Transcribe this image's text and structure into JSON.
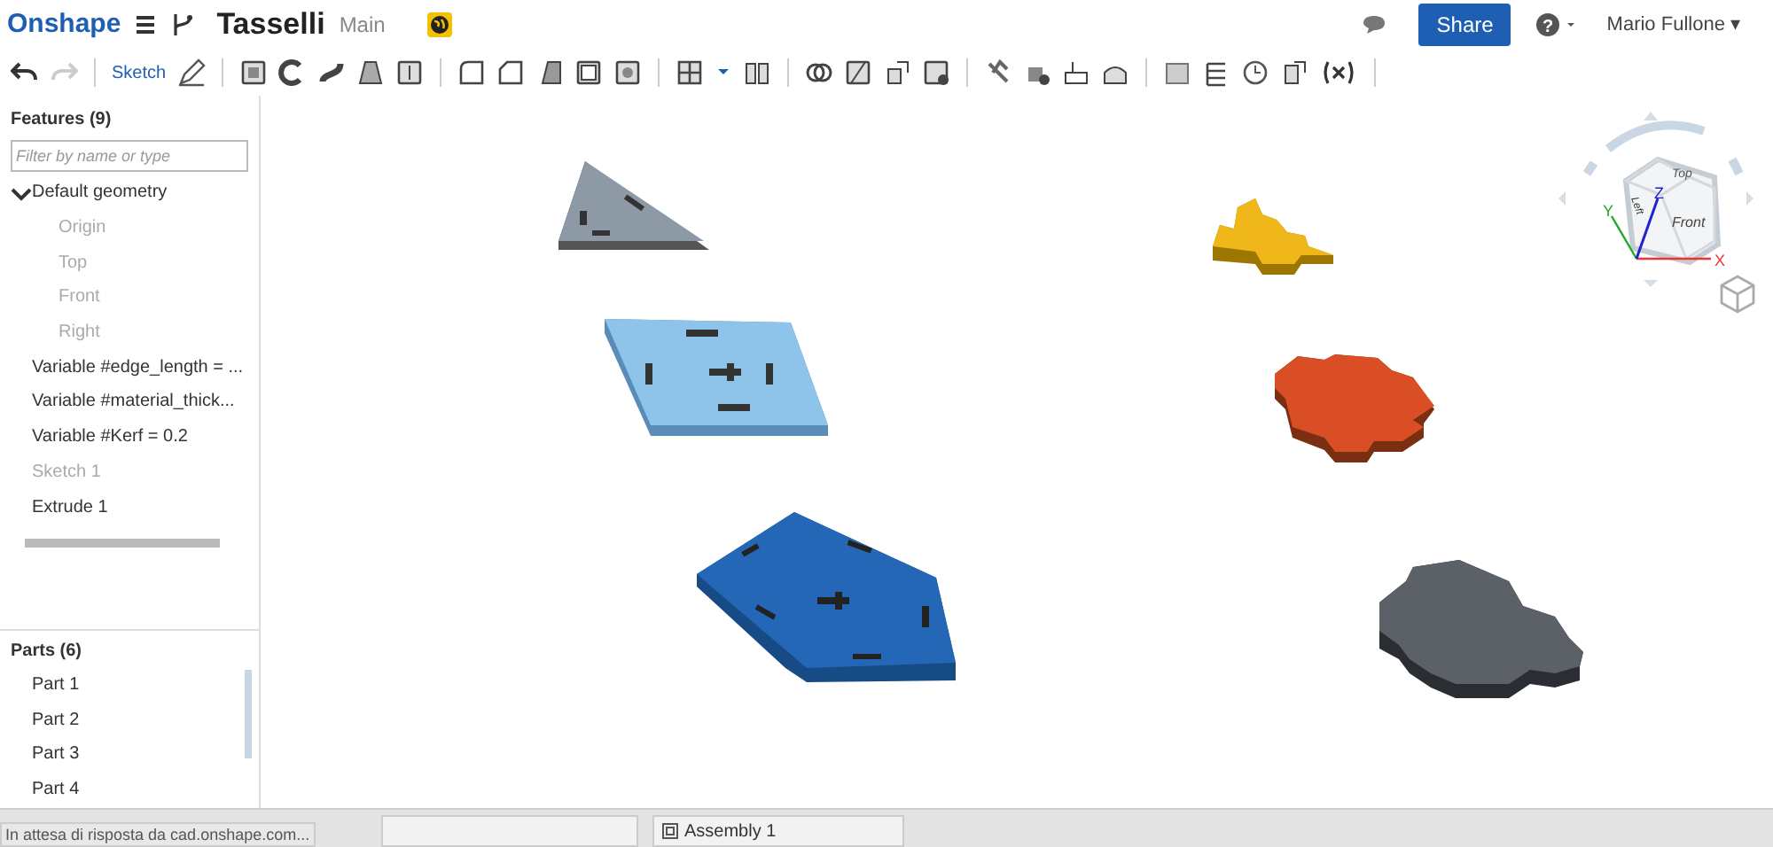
{
  "header": {
    "logo": "Onshape",
    "document_title": "Tasselli",
    "branch": "Main",
    "share": "Share",
    "help": "?",
    "user": "Mario Fullone",
    "user_caret": "▾"
  },
  "toolbar": {
    "sketch": "Sketch"
  },
  "features": {
    "title": "Features (9)",
    "filter": {
      "placeholder": "Filter by name or type"
    },
    "items": [
      {
        "label": "Default geometry",
        "expanded": true,
        "disabled": false,
        "children": [
          {
            "label": "Origin",
            "disabled": true
          },
          {
            "label": "Top",
            "disabled": true
          },
          {
            "label": "Front",
            "disabled": true
          },
          {
            "label": "Right",
            "disabled": true
          }
        ]
      },
      {
        "label": "Variable #edge_length = ...",
        "disabled": false
      },
      {
        "label": "Variable #material_thick...",
        "disabled": false
      },
      {
        "label": "Variable #Kerf = 0.2",
        "disabled": false
      },
      {
        "label": "Sketch 1",
        "disabled": true
      },
      {
        "label": "Extrude 1",
        "disabled": false
      }
    ]
  },
  "parts": {
    "title": "Parts (6)",
    "items": [
      "Part 1",
      "Part 2",
      "Part 3",
      "Part 4"
    ]
  },
  "view_cube": {
    "faces": [
      "Top",
      "Left",
      "Front"
    ],
    "axes": [
      "X",
      "Y",
      "Z"
    ]
  },
  "tabs": [
    {
      "label": "Assembly 1",
      "selected": false
    }
  ],
  "status": "In attesa di risposta da cad.onshape.com..."
}
